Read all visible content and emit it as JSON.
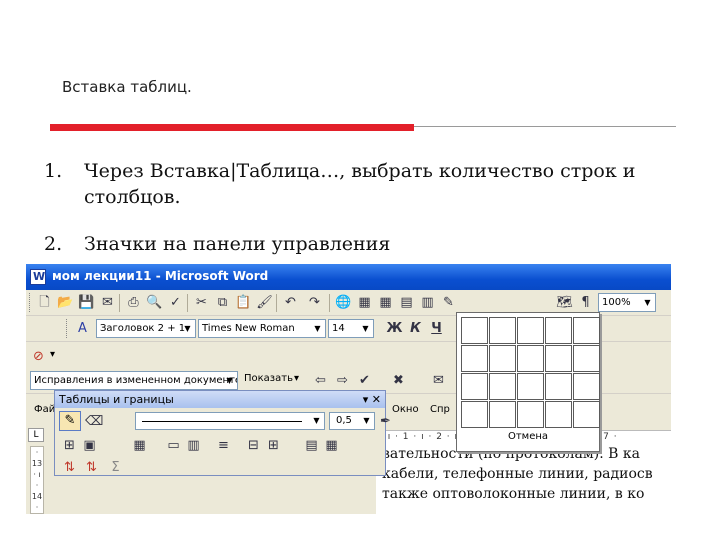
{
  "slide": {
    "title": "Вставка таблиц.",
    "items": [
      {
        "num": "1.",
        "text": "Через Вставка|Таблица…, выбрать количество строк и столбцов."
      },
      {
        "num": "2.",
        "text": "Значки на панели управления"
      }
    ]
  },
  "word": {
    "title": "мом лекции11 - Microsoft Word",
    "zoom": "100%",
    "style": "Заголовок 2 + 1",
    "font": "Times New Roman",
    "size": "14",
    "bold": "Ж",
    "italic": "К",
    "underline": "Ч",
    "review_mode": "Исправления в измененном документе",
    "show_label": "Показать",
    "menu_window": "Окно",
    "menu_help": "Спр",
    "menu_file_partial": "Фай",
    "tables_toolbar": {
      "title": "Таблицы и границы",
      "line_width": "0,5",
      "width_arrow": "▼"
    },
    "insert_table_grid": {
      "rows": 4,
      "cols": 5,
      "cancel_label": "Отмена"
    },
    "ruler_text": "· ı · 1 · ı · 2 · ı · 3 · ı · 4 · ı · 5 · ı · 6 · ı · 7 ·",
    "vruler_text": "· 13 · ı · 14 ·",
    "doc_lines": [
      "вательности (по протоколам). В ка",
      "кабели, телефонные линии, радиосв",
      "также оптоволоконные линии, в ко"
    ]
  }
}
